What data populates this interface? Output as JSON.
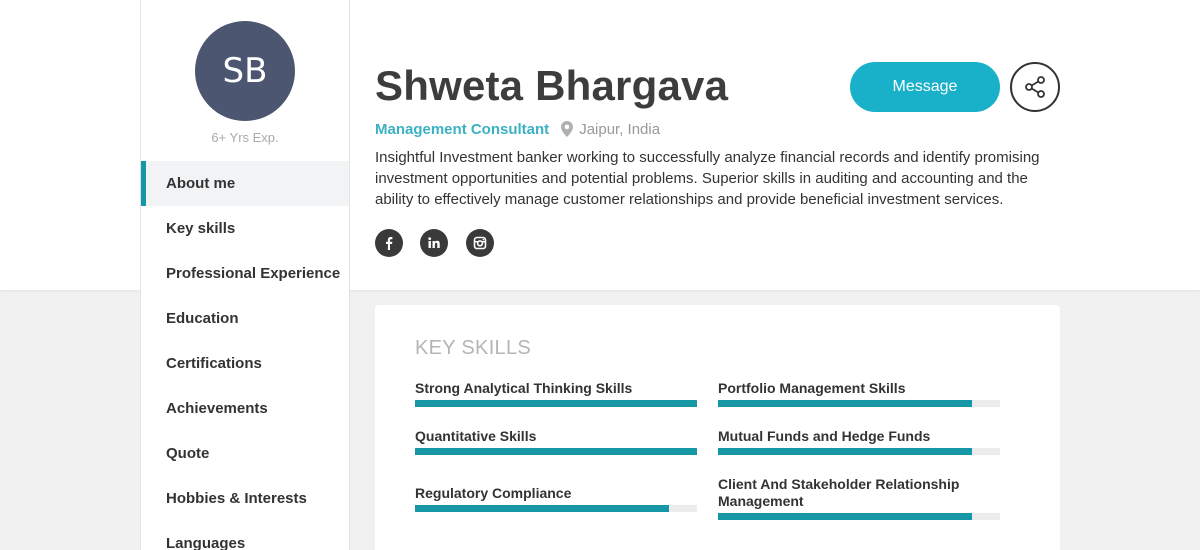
{
  "profile": {
    "initials": "SB",
    "experience": "6+ Yrs Exp.",
    "name": "Shweta Bhargava",
    "job_title": "Management Consultant",
    "location": "Jaipur, India",
    "bio": "Insightful Investment banker working to successfully analyze financial records and identify promising investment opportunities and potential problems. Superior skills in auditing and accounting and the ability to effectively manage customer relationships and provide beneficial investment services."
  },
  "actions": {
    "message_label": "Message"
  },
  "socials": [
    "facebook-icon",
    "linkedin-icon",
    "instagram-icon"
  ],
  "sidebar": {
    "items": [
      {
        "label": "About me",
        "active": true
      },
      {
        "label": "Key skills"
      },
      {
        "label": "Professional Experience"
      },
      {
        "label": "Education"
      },
      {
        "label": "Certifications"
      },
      {
        "label": "Achievements"
      },
      {
        "label": "Quote"
      },
      {
        "label": "Hobbies & Interests"
      },
      {
        "label": "Languages"
      }
    ]
  },
  "key_skills": {
    "title": "KEY SKILLS",
    "items": [
      {
        "label": "Strong Analytical Thinking Skills",
        "level": 1.0
      },
      {
        "label": "Portfolio Management Skills",
        "level": 0.9
      },
      {
        "label": "Quantitative Skills",
        "level": 1.0
      },
      {
        "label": "Mutual Funds and Hedge Funds",
        "level": 0.9
      },
      {
        "label": "Regulatory Compliance",
        "level": 0.9
      },
      {
        "label": "Client And Stakeholder Relationship Management",
        "level": 0.9
      }
    ]
  },
  "colors": {
    "accent": "#1597a6",
    "button": "#19b1c9",
    "avatar": "#4c5670",
    "title": "#3bb2c2"
  }
}
